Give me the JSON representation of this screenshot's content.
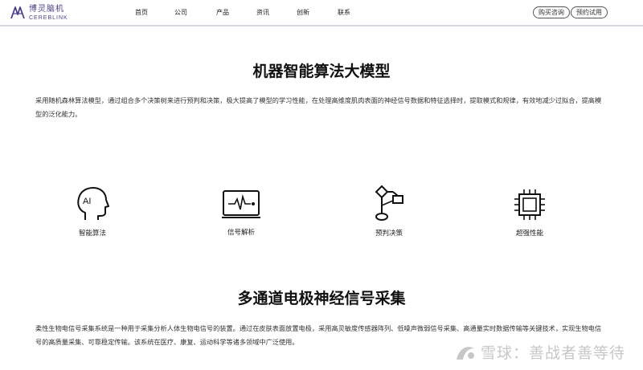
{
  "brand": {
    "name_cn": "博灵脑机",
    "name_en": "CEREBLINK"
  },
  "nav": {
    "items": [
      "首页",
      "公司",
      "产品",
      "资讯",
      "创新",
      "联系"
    ]
  },
  "header_buttons": {
    "consult": "购买咨询",
    "trial": "预约试用"
  },
  "section1": {
    "title": "机器智能算法大模型",
    "paragraph": "采用随机森林算法模型，通过组合多个决策树来进行预判和决策，极大提高了模型的学习性能，在处理高维度肌肉表面的神经信号数据和特征选择时，提取模式和规律，有效地减少过拟合，提高模型的泛化能力。"
  },
  "features": [
    {
      "label": "智能算法",
      "icon": "ai-head-icon"
    },
    {
      "label": "信号解析",
      "icon": "signal-monitor-icon"
    },
    {
      "label": "预判决策",
      "icon": "flowchart-icon"
    },
    {
      "label": "超强性能",
      "icon": "chip-icon"
    }
  ],
  "section2": {
    "title": "多通道电极神经信号采集",
    "paragraph": "柔性生物电信号采集系统是一种用于采集分析人体生物电信号的装置。通过在皮肤表面放置电极，采用高灵敏度传感器阵列、低噪声微弱信号采集、高通量实时数据传输等关键技术，实现生物电信号的高质量采集、可靠稳定传输。该系统在医疗、康复、运动科学等诸多领域中广泛使用。"
  },
  "watermark": {
    "text": "雪球：善战者善等待"
  },
  "colors": {
    "brand": "#4a3f8c",
    "text": "#222222",
    "header_line": "#d8d8e4"
  }
}
